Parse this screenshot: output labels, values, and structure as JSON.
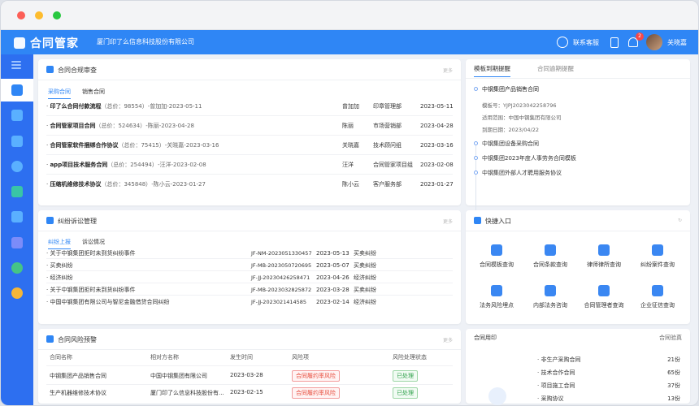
{
  "window": {
    "dots": [
      "#fc5f57",
      "#fdbc2e",
      "#28c840"
    ]
  },
  "topbar": {
    "logo": "合同管家",
    "company": "厦门印了么信息科技股份有限公司",
    "service": "联系客服",
    "notifications": "2",
    "user": "关晓嘉"
  },
  "sidebar": {
    "icons": [
      "menu-icon",
      "home-icon",
      "document-icon",
      "contract-icon",
      "yen-icon",
      "board-icon",
      "folder-icon",
      "chart-icon",
      "user-icon",
      "gear-icon"
    ]
  },
  "review": {
    "title": "合同合规审查",
    "more": "更多",
    "tabs": [
      "采购合同",
      "销售合同"
    ],
    "rows": [
      {
        "name": "印了么合同付款流程",
        "amount": "（总价：98554）",
        "by": "-曾加加-2023-05-11",
        "person": "曾加加",
        "dept": "印章管理部",
        "date": "2023-05-11"
      },
      {
        "name": "合同管家项目合同",
        "amount": "（总价：524634）",
        "by": "-陈丽-2023-04-28",
        "person": "陈丽",
        "dept": "市场营销部",
        "date": "2023-04-28"
      },
      {
        "name": "合同管家软件捆绑合作协议",
        "amount": "（总价：75415）",
        "by": "-关晓嘉-2023-03-16",
        "person": "关晓嘉",
        "dept": "技术顾问组",
        "date": "2023-03-16"
      },
      {
        "name": "app项目技术服务合同",
        "amount": "（总价：254494）",
        "by": "-汪洋-2023-02-08",
        "person": "汪洋",
        "dept": "合同管家项目组",
        "date": "2023-02-08"
      },
      {
        "name": "压缩机维修技术协议",
        "amount": "（总价：345848）",
        "by": "-陈小云-2023-01-27",
        "person": "陈小云",
        "dept": "客户服务部",
        "date": "2023-01-27"
      }
    ]
  },
  "reminder": {
    "tabs": [
      "模板到期提醒",
      "合同逾期提醒"
    ],
    "first": {
      "title": "中钢集团产品销售合同",
      "number": "模板号：YJPJ2023042258796",
      "scope": "适用范围：中国中钢集团有限公司",
      "expiry": "到期日期：2023/04/22"
    },
    "items": [
      "中钢集团设备采购合同",
      "中钢集团2023年度人事劳务合同模板",
      "中钢集团外部人才聘用服务协议"
    ]
  },
  "dispute": {
    "title": "纠纷诉讼管理",
    "more": "更多",
    "tabs": [
      "纠纷上报",
      "诉讼情况"
    ],
    "rows": [
      {
        "name": "关于中钢集团拒时未到货纠纷事件",
        "code": "JF-NM-2023051330457",
        "date": "2023-05-13",
        "type": "买卖纠纷"
      },
      {
        "name": "买卖纠纷",
        "code": "JF-MB-2023050720695",
        "date": "2023-05-07",
        "type": "买卖纠纷"
      },
      {
        "name": "经济纠纷",
        "code": "JF-JJ-2023042625847​1",
        "date": "2023-04-26",
        "type": "经济纠纷"
      },
      {
        "name": "关于中钢集团拒时未到货纠纷事件",
        "code": "JF-MB-2023032825872",
        "date": "2023-03-28",
        "type": "买卖纠纷"
      },
      {
        "name": "中国中钢集团有限公司与智尼金融借贷合同纠纷",
        "code": "JF-JJ-2023021414585",
        "date": "2023-02-14",
        "type": "经济纠纷"
      }
    ]
  },
  "quick": {
    "title": "快捷入口",
    "items": [
      "合同模板查询",
      "合同条款查询",
      "律师律所查询",
      "纠纷案件查询",
      "法务风险埋点",
      "内部法务咨询",
      "合同管理者查询",
      "企业征信查询"
    ]
  },
  "risk": {
    "title": "合同风险预警",
    "more": "更多",
    "headers": [
      "合同名称",
      "相对方名称",
      "发生时间",
      "风险项",
      "风险处理状态"
    ],
    "rows": [
      {
        "name": "中钢集团产品销售合同",
        "party": "中国中钢集团有限公司",
        "time": "2023-03-28",
        "risk": "合同履约率风险",
        "status": "已处理"
      },
      {
        "name": "生产机器维修技术协议",
        "party": "厦门印了么信息科技股份有...",
        "time": "2023-02-15",
        "risk": "合同履约率风险",
        "status": "已处理"
      }
    ]
  },
  "seal": {
    "title": "合同用印",
    "link": "合同验真",
    "rows": [
      {
        "name": "非生产采购合同",
        "count": "21份"
      },
      {
        "name": "技术合作合同",
        "count": "65份"
      },
      {
        "name": "项目施工合同",
        "count": "37份"
      },
      {
        "name": "采购协议",
        "count": "13份"
      }
    ]
  }
}
